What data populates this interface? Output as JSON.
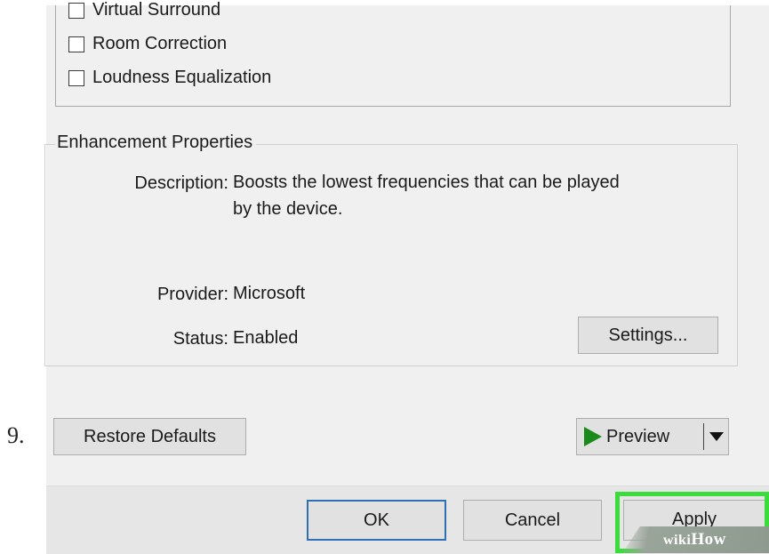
{
  "step_number": "9.",
  "enhancements": [
    {
      "label": "Virtual Surround",
      "checked": false
    },
    {
      "label": "Room Correction",
      "checked": false
    },
    {
      "label": "Loudness Equalization",
      "checked": false
    }
  ],
  "enhancement_properties": {
    "title": "Enhancement Properties",
    "description_label": "Description:",
    "description_line1": "Boosts the lowest frequencies that can be played",
    "description_line2": "by the device.",
    "provider_label": "Provider:",
    "provider_value": "Microsoft",
    "status_label": "Status:",
    "status_value": "Enabled",
    "settings_button": "Settings..."
  },
  "buttons": {
    "restore_defaults": "Restore Defaults",
    "preview": "Preview",
    "ok": "OK",
    "cancel": "Cancel",
    "apply": "Apply"
  },
  "watermark": {
    "wiki": "wiki",
    "how": "How"
  },
  "colors": {
    "highlight": "#3ddc3d",
    "play": "#1a8a1a",
    "ok_border": "#2f6fb4"
  }
}
